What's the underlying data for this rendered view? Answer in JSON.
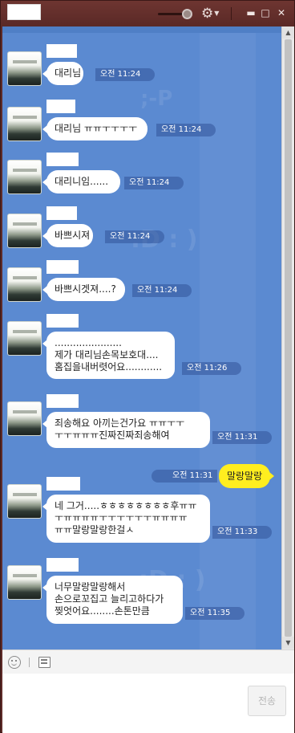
{
  "window": {
    "controls": {
      "minimize": "▬",
      "maximize": "□",
      "close": "✕"
    }
  },
  "messages": [
    {
      "sender": "other",
      "lines": [
        "대리님"
      ],
      "time": "오전 11:24"
    },
    {
      "sender": "other",
      "lines": [
        "대리님 ㅠㅠㅜㅜㅜㅜ"
      ],
      "time": "오전 11:24"
    },
    {
      "sender": "other",
      "lines": [
        "대리니임......"
      ],
      "time": "오전 11:24"
    },
    {
      "sender": "other",
      "lines": [
        "바쁘시져"
      ],
      "time": "오전 11:24"
    },
    {
      "sender": "other",
      "lines": [
        "바쁘시겟져....?"
      ],
      "time": "오전 11:24"
    },
    {
      "sender": "other",
      "lines": [
        "......................",
        "제가 대리님손목보호대....",
        "홈집을내버렷어요............"
      ],
      "time": "오전 11:26"
    },
    {
      "sender": "other",
      "lines": [
        "죄송해요 아끼는건가요 ㅠㅠㅜㅜ",
        "ㅜㅜㅠㅠㅠ진짜진짜죄송해여"
      ],
      "time": "오전 11:31"
    },
    {
      "sender": "me",
      "lines": [
        "말랑말랑"
      ],
      "time": "오전 11:31"
    },
    {
      "sender": "other",
      "lines": [
        "네 그거.....ㅎㅎㅎㅎㅎㅎㅎㅎ후ㅠㅠ",
        "ㅜㅠㅠㅠㅠㅜㅜㅜㅜㅜㅜㅠㅠㅠㅠ",
        "ㅠㅠ말랑말랑한걸ㅅ"
      ],
      "time": "오전 11:33"
    },
    {
      "sender": "other",
      "lines": [
        "너무말랑말랑해서",
        "손으로꼬집고 늘리고하다가",
        "찢엇어요........손톤만큼"
      ],
      "time": "오전 11:35"
    }
  ],
  "composer": {
    "send_label": "전송",
    "input_value": ""
  },
  "icons": {
    "gear": "⚙",
    "emoji": "emoji-icon",
    "file": "file-icon"
  },
  "colors": {
    "titlebar": "#5e2b28",
    "chat_background": "#5b8ad1",
    "my_bubble": "#ffee1f",
    "other_bubble": "#ffffff"
  }
}
